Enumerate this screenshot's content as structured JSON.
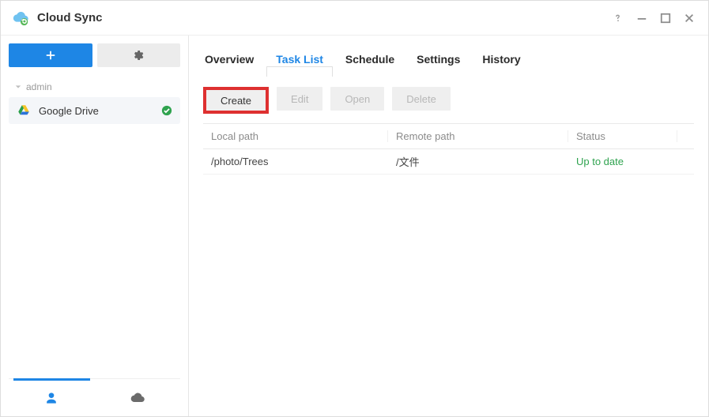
{
  "window": {
    "title": "Cloud Sync"
  },
  "sidebar": {
    "group_label": "admin",
    "connections": [
      {
        "label": "Google Drive",
        "status": "ok"
      }
    ]
  },
  "tabs": {
    "items": [
      "Overview",
      "Task List",
      "Schedule",
      "Settings",
      "History"
    ],
    "active_index": 1
  },
  "toolbar": {
    "create": "Create",
    "edit": "Edit",
    "open": "Open",
    "delete": "Delete"
  },
  "table": {
    "headers": {
      "local": "Local path",
      "remote": "Remote path",
      "status": "Status"
    },
    "rows": [
      {
        "local": "/photo/Trees",
        "remote": "/文件",
        "status": "Up to date"
      }
    ]
  }
}
